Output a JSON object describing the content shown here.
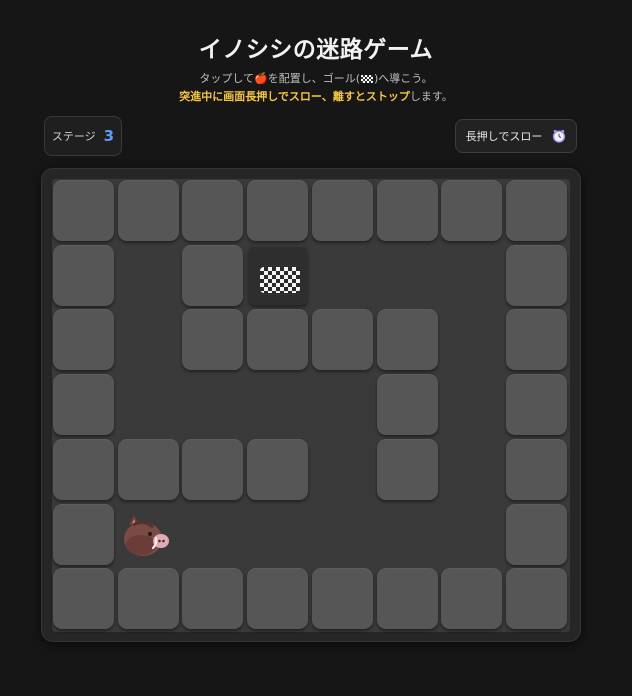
{
  "header": {
    "title": "イノシシの迷路ゲーム",
    "instruction_part1": "タップして",
    "apple_icon": "🍎",
    "instruction_part2": "を配置し、ゴール(",
    "instruction_part3": ")へ導こう。",
    "tip_highlight1": "突進中に画面長押しでスロー、離すとストップ",
    "tip_rest": "します。"
  },
  "stage": {
    "label": "ステージ",
    "number": "3"
  },
  "slow_button": {
    "label": "長押しでスロー",
    "icon": "clock-icon"
  },
  "colors": {
    "background": "#161616",
    "wall": "#565656",
    "floor": "#3a3a3a",
    "highlight": "#f5c542",
    "stage_number": "#5b9cf5"
  },
  "maze": {
    "rows": 7,
    "cols": 8,
    "legend": {
      "#": "wall",
      ".": "floor",
      "G": "goal",
      "B": "boar"
    },
    "map": [
      "########",
      "#.#G...#",
      "#.####.#",
      "#....#.#",
      "####.#.#",
      "#B.....#",
      "########"
    ]
  }
}
